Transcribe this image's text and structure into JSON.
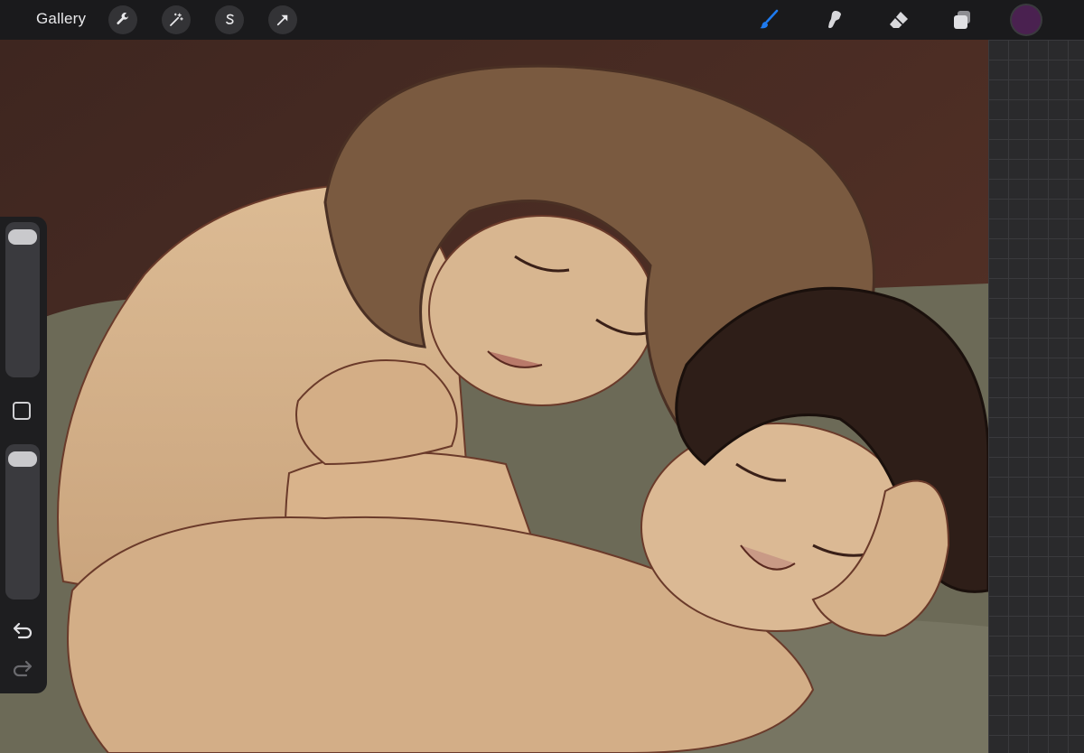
{
  "toolbar": {
    "gallery_label": "Gallery",
    "left_tools": [
      "wrench-icon",
      "magic-wand-icon",
      "selection-s-icon",
      "transform-arrow-icon"
    ],
    "right_tools": [
      "brush-icon",
      "smudge-icon",
      "eraser-icon",
      "layers-icon"
    ],
    "active_tool": "brush-icon",
    "current_color": "#4a2150"
  },
  "sidebar": {
    "brush_size_slider": "slider",
    "opacity_slider": "slider",
    "modify_button": "square-icon",
    "undo": "undo-icon",
    "redo": "redo-icon"
  },
  "colors": {
    "accent": "#1e7bf0",
    "toolbar_bg": "#1a1a1c",
    "background_brown": "#4a2a22",
    "skin": "#d7b48e",
    "hair_light": "#7a5a40",
    "hair_dark": "#2e1e18",
    "sheet": "#6f6a55"
  }
}
